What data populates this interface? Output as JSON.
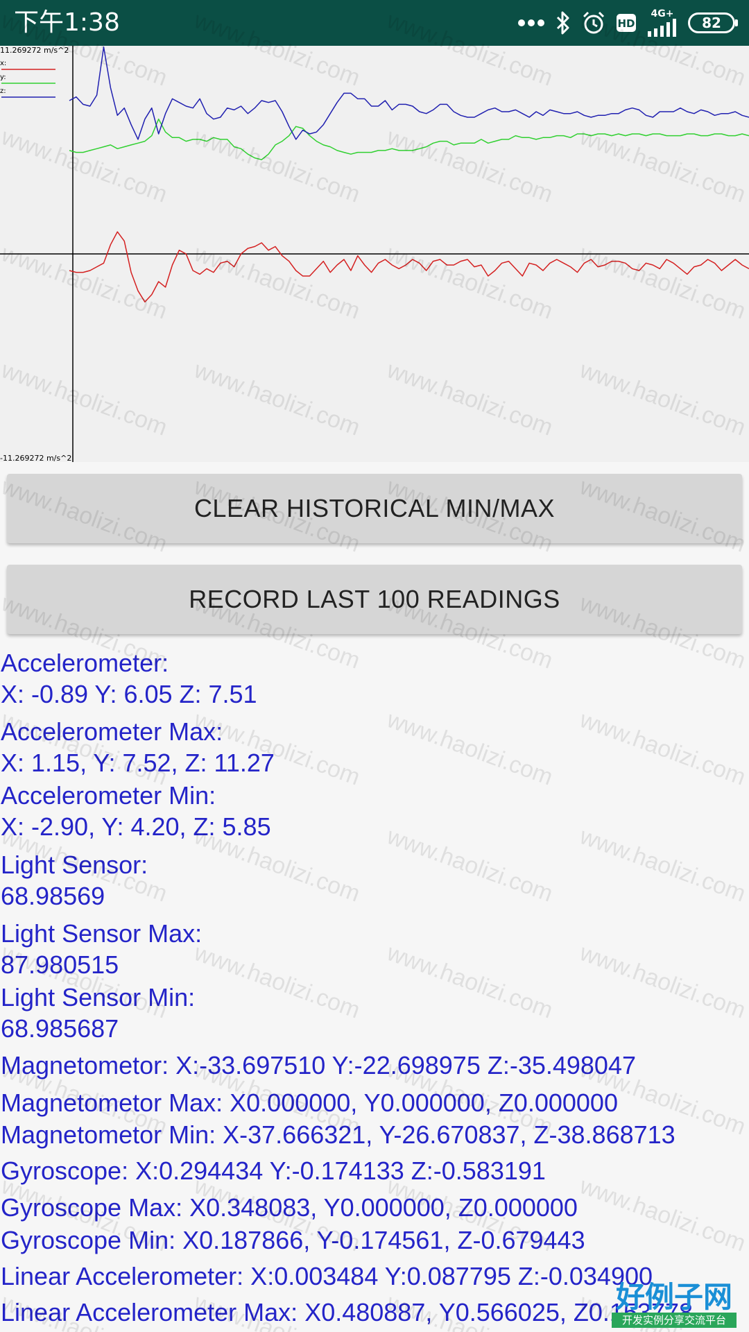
{
  "status_bar": {
    "time": "下午1:38",
    "network": "4G+",
    "battery": "82",
    "colors": {
      "background": "#0b4f45",
      "foreground": "#ffffff"
    },
    "icons": [
      "more-dots-icon",
      "bluetooth-icon",
      "alarm-icon",
      "hd-icon",
      "signal-icon",
      "battery-icon"
    ]
  },
  "chart": {
    "max_label": "11.269272 m/s^2",
    "min_label": "-11.269272 m/s^2",
    "legend": [
      "x:",
      "y:",
      "z:"
    ],
    "colors": {
      "x": "#d42020",
      "y": "#30d030",
      "z": "#2020b0",
      "axis": "#000000"
    }
  },
  "chart_data": {
    "type": "line",
    "ylim": [
      -11.269272,
      11.269272
    ],
    "grid": false,
    "legend_position": "top-left",
    "series": [
      {
        "name": "x:",
        "color": "#d42020",
        "values": [
          -0.9,
          -1.0,
          -1.0,
          -0.9,
          -0.7,
          -0.5,
          0.5,
          1.2,
          0.7,
          -1.0,
          -2.0,
          -2.6,
          -2.2,
          -1.5,
          -1.8,
          -0.6,
          0.2,
          0.0,
          -0.9,
          -1.1,
          -0.8,
          -1.0,
          -0.5,
          -0.4,
          -0.7,
          0.0,
          0.3,
          0.4,
          0.6,
          0.2,
          0.4,
          -0.1,
          -0.4,
          -0.9,
          -1.2,
          -1.2,
          -0.8,
          -0.4,
          -1.0,
          -0.6,
          -0.3,
          -0.9,
          -0.1,
          -0.6,
          -1.0,
          -0.5,
          -0.3,
          -0.6,
          -0.8,
          -0.6,
          -0.3,
          -0.5,
          -0.9,
          -0.4,
          -0.3,
          -0.6,
          -0.6,
          -0.4,
          -0.3,
          -0.7,
          -0.6,
          -1.2,
          -0.9,
          -0.5,
          -0.4,
          -0.8,
          -1.2,
          -0.5,
          -0.6,
          -0.9,
          -0.5,
          -0.3,
          -0.5,
          -0.7,
          -1.0,
          -0.5,
          -0.3,
          -0.7,
          -0.6,
          -0.4,
          -0.4,
          -0.5,
          -0.8,
          -0.9,
          -0.5,
          -0.6,
          -0.8,
          -0.3,
          -0.5,
          -0.8,
          -1.1,
          -0.7,
          -0.6,
          -0.3,
          -0.5,
          -0.9,
          -0.6,
          -0.3,
          -0.6,
          -0.8
        ]
      },
      {
        "name": "y:",
        "color": "#30d030",
        "values": [
          5.6,
          5.5,
          5.5,
          5.6,
          5.7,
          5.8,
          5.9,
          5.7,
          5.8,
          5.9,
          6.0,
          6.1,
          6.4,
          7.3,
          6.6,
          6.3,
          6.3,
          6.1,
          6.2,
          6.2,
          6.1,
          6.3,
          6.2,
          6.2,
          5.8,
          5.7,
          5.4,
          5.2,
          5.1,
          5.4,
          5.9,
          6.1,
          6.4,
          6.9,
          6.8,
          6.4,
          6.1,
          5.9,
          5.8,
          5.6,
          5.5,
          5.4,
          5.5,
          5.5,
          5.5,
          5.6,
          5.6,
          5.7,
          5.6,
          5.6,
          5.6,
          5.7,
          5.8,
          6.0,
          6.1,
          6.1,
          5.9,
          6.0,
          6.0,
          6.0,
          6.2,
          6.0,
          6.1,
          6.2,
          6.2,
          6.4,
          6.3,
          6.3,
          6.2,
          6.3,
          6.3,
          6.4,
          6.4,
          6.3,
          6.5,
          6.5,
          6.4,
          6.5,
          6.5,
          6.4,
          6.5,
          6.4,
          6.5,
          6.5,
          6.4,
          6.5,
          6.5,
          6.4,
          6.4,
          6.4,
          6.5,
          6.5,
          6.4,
          6.4,
          6.5,
          6.5,
          6.4,
          6.4,
          6.5,
          6.4
        ]
      },
      {
        "name": "z:",
        "color": "#2020b0",
        "values": [
          8.3,
          8.5,
          8.1,
          8.0,
          8.6,
          11.2,
          9.0,
          7.5,
          7.9,
          7.0,
          6.2,
          7.3,
          7.9,
          6.5,
          7.6,
          8.4,
          8.2,
          8.0,
          7.9,
          8.4,
          7.6,
          7.3,
          7.4,
          7.9,
          7.8,
          8.0,
          7.6,
          7.9,
          8.3,
          8.2,
          8.3,
          7.7,
          6.9,
          6.2,
          6.7,
          6.5,
          6.6,
          7.0,
          7.6,
          8.2,
          8.7,
          8.7,
          8.4,
          8.4,
          8.0,
          8.0,
          8.3,
          7.8,
          8.1,
          8.1,
          8.0,
          7.7,
          7.6,
          7.8,
          8.1,
          8.1,
          7.7,
          7.5,
          7.4,
          7.4,
          7.6,
          7.8,
          7.9,
          7.7,
          7.7,
          7.8,
          7.6,
          7.4,
          7.7,
          7.5,
          7.8,
          7.7,
          7.6,
          7.6,
          7.7,
          7.5,
          7.4,
          7.5,
          7.5,
          7.6,
          7.6,
          7.8,
          7.9,
          7.8,
          7.5,
          7.4,
          7.7,
          7.7,
          7.7,
          7.9,
          7.7,
          7.6,
          7.8,
          7.7,
          7.5,
          7.6,
          7.6,
          7.7,
          7.5,
          7.4
        ]
      }
    ]
  },
  "buttons": {
    "clear": "CLEAR HISTORICAL MIN/MAX",
    "record": "RECORD LAST 100 READINGS"
  },
  "readings": {
    "color": "#2424c8",
    "lines": [
      "Accelerometer:",
      "X: -0.89 Y: 6.05 Z: 7.51",
      "Accelerometer Max:",
      "X: 1.15, Y: 7.52, Z: 11.27",
      "Accelerometer Min:",
      "X: -2.90, Y: 4.20, Z: 5.85",
      "Light Sensor:",
      "68.98569",
      "Light Sensor Max:",
      "87.980515",
      "Light Sensor Min:",
      "68.985687",
      "Magnetometor: X:-33.697510 Y:-22.698975 Z:-35.498047",
      "Magnetometor Max: X0.000000, Y0.000000, Z0.000000",
      "Magnetometor Min: X-37.666321, Y-26.670837, Z-38.868713",
      "Gyroscope: X:0.294434 Y:-0.174133 Z:-0.583191",
      "Gyroscope Max: X0.348083, Y0.000000, Z0.000000",
      "Gyroscope Min: X0.187866, Y-0.174561, Z-0.679443",
      "Linear Accelerometer: X:0.003484 Y:0.087795 Z:-0.034900",
      "Linear Accelerometer Max: X0.480887, Y0.566025, Z0.153778"
    ]
  },
  "watermark": {
    "text": "www.haolizi.com",
    "logo_top": "好例子网",
    "logo_bottom": "开发实例分享交流平台"
  }
}
